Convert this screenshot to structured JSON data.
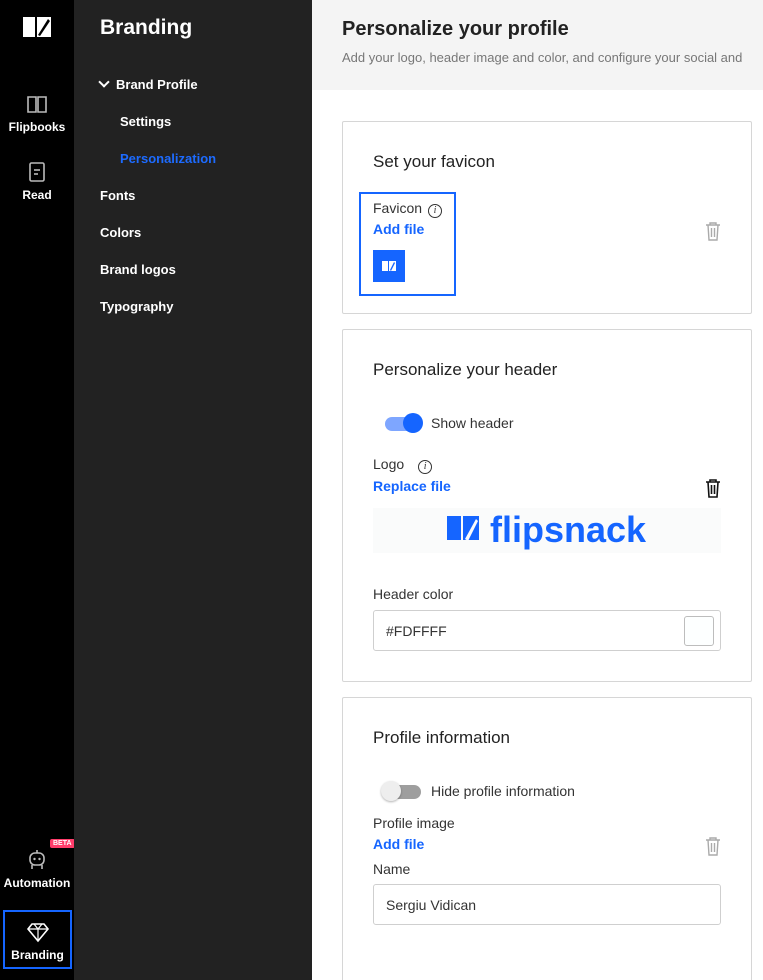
{
  "rail": {
    "items": [
      {
        "label": "Flipbooks",
        "icon": "book-open-icon"
      },
      {
        "label": "Read",
        "icon": "read-doc-icon"
      },
      {
        "label": "Automation",
        "icon": "robot-icon",
        "badge": "BETA"
      },
      {
        "label": "Branding",
        "icon": "diamond-icon",
        "selected": true
      }
    ]
  },
  "sidebar": {
    "title": "Branding",
    "items": [
      {
        "label": "Brand Profile",
        "expanded": true
      },
      {
        "label": "Settings"
      },
      {
        "label": "Personalization",
        "active": true
      },
      {
        "label": "Fonts"
      },
      {
        "label": "Colors"
      },
      {
        "label": "Brand logos"
      },
      {
        "label": "Typography"
      }
    ]
  },
  "main": {
    "title": "Personalize your profile",
    "subtitle": "Add your logo, header image and color, and configure your social and"
  },
  "favicon_card": {
    "title": "Set your favicon",
    "label": "Favicon",
    "info": "i",
    "add_file": "Add file"
  },
  "header_card": {
    "title": "Personalize your header",
    "show_header_label": "Show header",
    "show_header": true,
    "logo_label": "Logo",
    "info": "i",
    "replace_file": "Replace file",
    "logo_text": "flipsnack",
    "header_color_label": "Header color",
    "header_color_value": "#FDFFFF"
  },
  "profile_card": {
    "title": "Profile information",
    "hide_profile_label": "Hide profile information",
    "hide_profile": false,
    "profile_image_label": "Profile image",
    "add_file": "Add file",
    "name_label": "Name",
    "name_value": "Sergiu Vidican"
  },
  "colors": {
    "accent": "#1565ff",
    "rail_bg": "#000000",
    "sidebar_bg": "#222222",
    "beta_badge": "#ff3d6b"
  }
}
